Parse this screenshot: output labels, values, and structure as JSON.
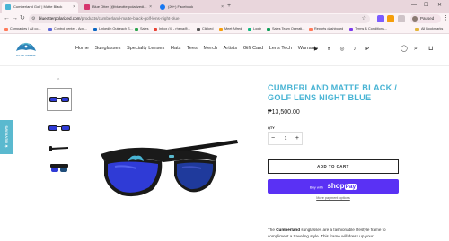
{
  "browser": {
    "tabs": [
      {
        "title": "Cumberland Golf | Matte Black",
        "favicon_color": "#49b4d4",
        "active": true
      },
      {
        "title": "Blue Otter (@blueotterpolarizedi...",
        "favicon_color": "#d6336c",
        "active": false
      },
      {
        "title": "(20+) Facebook",
        "favicon_color": "#1877f2",
        "active": false
      }
    ],
    "new_tab_glyph": "+",
    "close_glyph": "×",
    "window_controls": [
      "—",
      "☐",
      "✕"
    ],
    "url_host": "blueotterpolarized.com",
    "url_path": "/products/cumberland-matte-black-golf-lens-night-blue",
    "profile_label": "Paused",
    "bookmarks": [
      {
        "label": "Companies | All co...",
        "color": "#ff7a59"
      },
      {
        "label": "Control center - App...",
        "color": "#5a67d8"
      },
      {
        "label": "LinkedIn Outreach S...",
        "color": "#0a66c2"
      },
      {
        "label": "Sales",
        "color": "#2da44e"
      },
      {
        "label": "Inbox (4) - rhena@...",
        "color": "#ea4335"
      },
      {
        "label": "Clicked",
        "color": "#555555"
      },
      {
        "label": "Meet Alfred",
        "color": "#f59e0b"
      },
      {
        "label": "Login",
        "color": "#10b981"
      },
      {
        "label": "Sales Team Operati...",
        "color": "#0f9d58"
      },
      {
        "label": "Reports dashboard",
        "color": "#ff7a59"
      },
      {
        "label": "Terms & Conditions...",
        "color": "#7c3aed"
      }
    ],
    "all_bookmarks": "All Bookmarks"
  },
  "site": {
    "logo_text": "BLUE OTTER",
    "logo_color": "#2d82b8",
    "accent": "#49b4d4",
    "nav": [
      "Home",
      "Sunglasses",
      "Specialty Lenses",
      "Hats",
      "Tees",
      "Merch",
      "Artists",
      "Gift Card",
      "Lens Tech",
      "Warranty"
    ],
    "social_icons": [
      "youtube-icon",
      "facebook-icon",
      "instagram-icon",
      "tiktok-icon",
      "pinterest-icon"
    ],
    "header_icons": [
      "account-icon",
      "search-icon",
      "cart-icon"
    ],
    "reviews_tab": "★ REVIEWS"
  },
  "product": {
    "title": "CUMBERLAND MATTE BLACK / GOLF LENS NIGHT BLUE",
    "price": "₱13,500.00",
    "qty_label": "QTY",
    "qty_value": "1",
    "add_to_cart": "ADD TO CART",
    "buy_with": "Buy with",
    "shop_pay_brand": "shop",
    "shop_pay_suffix": "Pay",
    "more_payment": "More payment options",
    "description_bold": "Cumberland",
    "description_pre": "The ",
    "description_post": " sunglasses are a fashionable lifestyle frame to compliment a traveling style. This frame will dress up your",
    "frame_color": "#1a1a1a",
    "lens_color": "#2f3bd6"
  }
}
